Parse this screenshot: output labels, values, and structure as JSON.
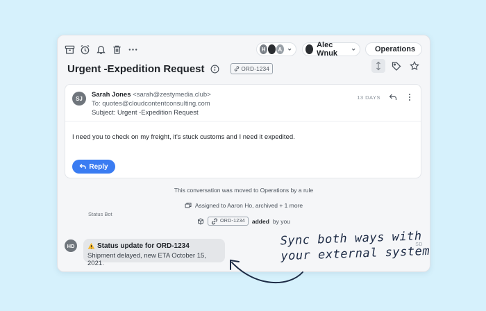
{
  "toolbar": {
    "assignee_avatars": [
      "H",
      "",
      "A"
    ],
    "assignee_name": "Alec Wnuk",
    "team_name": "Operations",
    "team_color": "#e5484d"
  },
  "conversation": {
    "title": "Urgent -Expedition Request",
    "order_tag": "ORD-1234"
  },
  "email": {
    "sender_initials": "SJ",
    "sender_name": "Sarah Jones",
    "sender_email": "<sarah@zestymedia.club>",
    "to_line": "To: quotes@cloudcontentconsulting.com",
    "subject_line": "Subject: Urgent -Expedition Request",
    "age": "13 DAYS",
    "body": "I need you to check on my freight, it's stuck customs and I need it expedited.",
    "reply_label": "Reply"
  },
  "events": {
    "moved": "This conversation was moved to Operations by a rule",
    "assigned": "Assigned to Aaron Ho, archived + 1 more",
    "tag": "ORD-1234",
    "tag_added": "added",
    "tag_by": "by you"
  },
  "bot": {
    "label": "Status Bot",
    "initials": "HD",
    "title": "Status update for ORD-1234",
    "subtitle": "Shipment delayed, new ETA October 15, 2021.",
    "side_initials": "SD"
  },
  "annotation": {
    "line1": "Sync both ways with",
    "line2": "your external system"
  },
  "colors": {
    "accent": "#3a7cf2",
    "background": "#d6f1fc"
  }
}
